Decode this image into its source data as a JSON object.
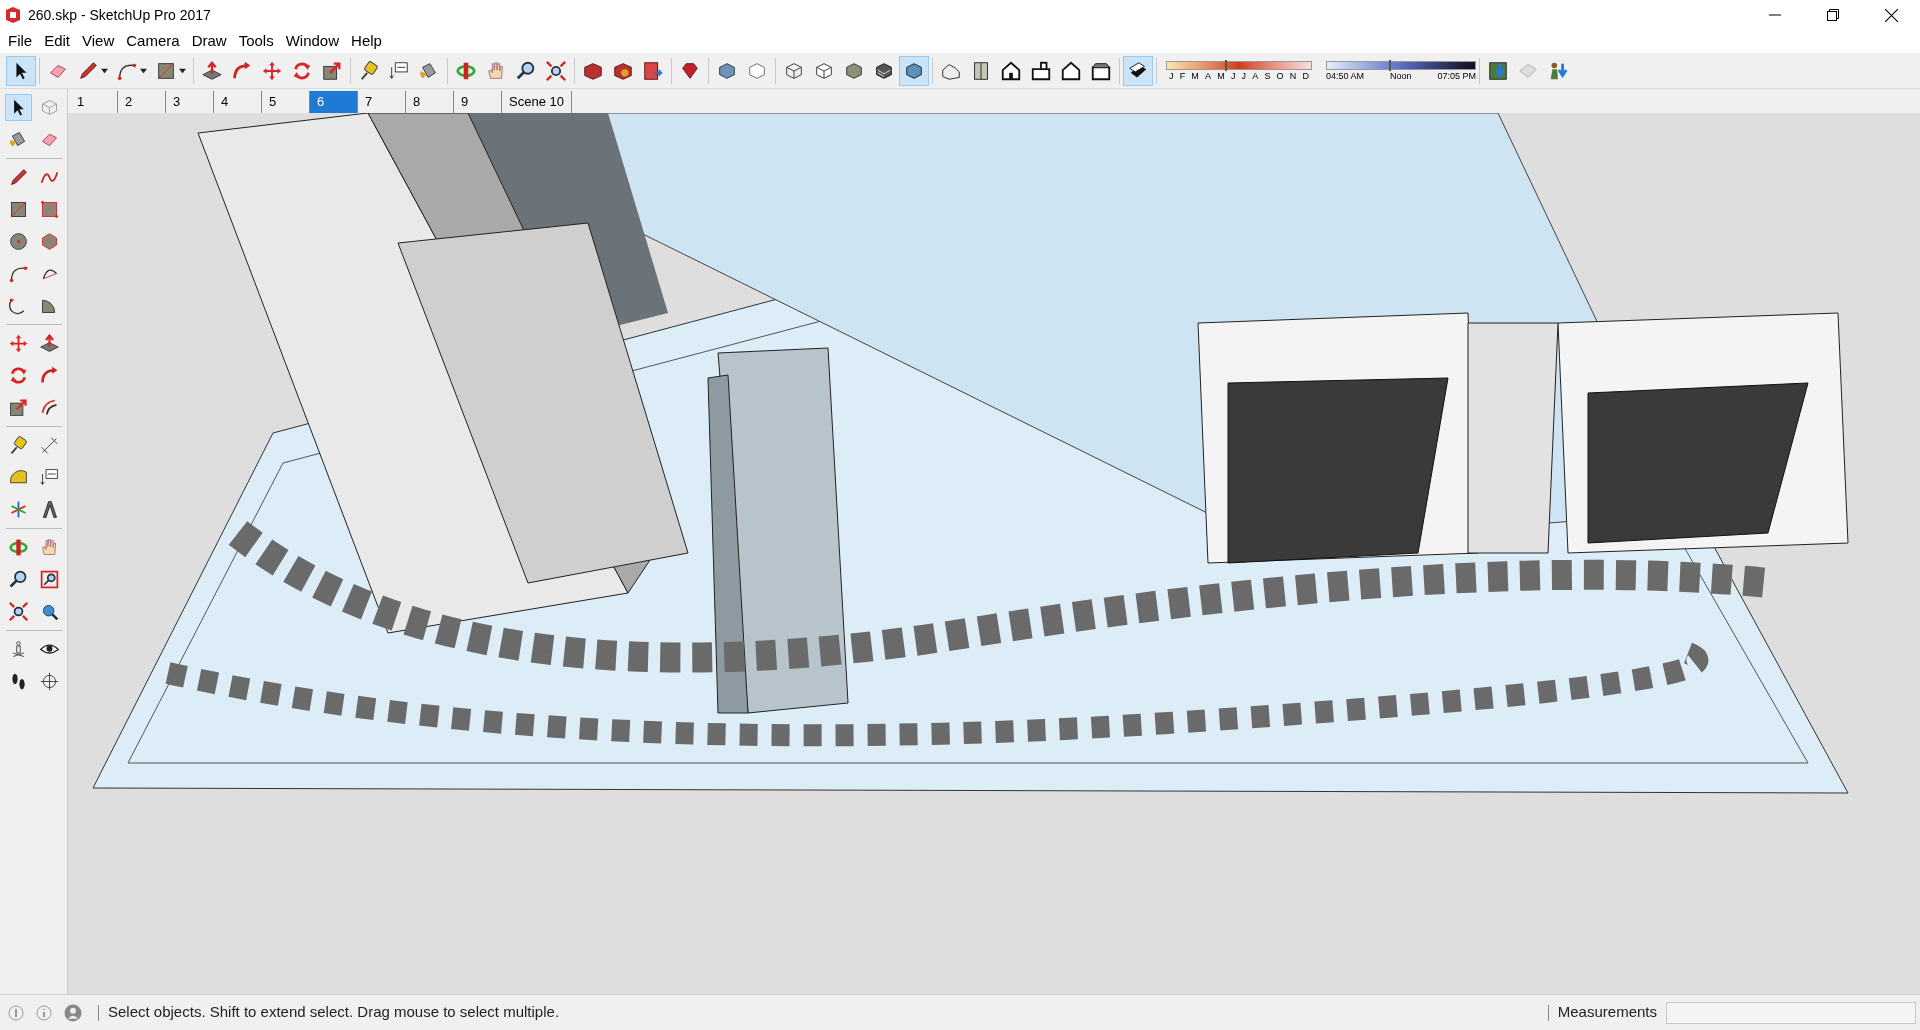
{
  "window": {
    "title": "260.skp - SketchUp Pro 2017"
  },
  "menu": [
    "File",
    "Edit",
    "View",
    "Camera",
    "Draw",
    "Tools",
    "Window",
    "Help"
  ],
  "main_toolbar": [
    [
      {
        "kind": "select",
        "selected": true,
        "dropdown": false
      }
    ],
    [
      {
        "kind": "eraser",
        "selected": false,
        "dropdown": false
      },
      {
        "kind": "pencil",
        "selected": false,
        "dropdown": true
      },
      {
        "kind": "arc",
        "selected": false,
        "dropdown": true
      },
      {
        "kind": "rectangle",
        "selected": false,
        "dropdown": true
      }
    ],
    [
      {
        "kind": "pushpull",
        "selected": false,
        "dropdown": false
      },
      {
        "kind": "followme",
        "selected": false,
        "dropdown": false
      },
      {
        "kind": "move",
        "selected": false,
        "dropdown": false
      },
      {
        "kind": "rotate",
        "selected": false,
        "dropdown": false
      },
      {
        "kind": "scale",
        "selected": false,
        "dropdown": false
      }
    ],
    [
      {
        "kind": "tape",
        "selected": false,
        "dropdown": false
      },
      {
        "kind": "text",
        "selected": false,
        "dropdown": false
      },
      {
        "kind": "paint",
        "selected": false,
        "dropdown": false
      }
    ],
    [
      {
        "kind": "orbit",
        "selected": false,
        "dropdown": false
      },
      {
        "kind": "pan",
        "selected": false,
        "dropdown": false
      },
      {
        "kind": "zoom",
        "selected": false,
        "dropdown": false
      },
      {
        "kind": "zoomext",
        "selected": false,
        "dropdown": false
      }
    ],
    [
      {
        "kind": "warehouse",
        "selected": false,
        "dropdown": false
      },
      {
        "kind": "extensions",
        "selected": false,
        "dropdown": false
      },
      {
        "kind": "send",
        "selected": false,
        "dropdown": false
      }
    ],
    [
      {
        "kind": "ruby",
        "selected": false,
        "dropdown": false
      }
    ],
    [
      {
        "kind": "xray",
        "selected": false,
        "dropdown": false
      },
      {
        "kind": "backedges",
        "selected": false,
        "dropdown": false
      }
    ],
    [
      {
        "kind": "wireframe",
        "selected": false,
        "dropdown": false
      },
      {
        "kind": "hiddenline",
        "selected": false,
        "dropdown": false
      },
      {
        "kind": "shaded",
        "selected": false,
        "dropdown": false
      },
      {
        "kind": "textured",
        "selected": false,
        "dropdown": false
      },
      {
        "kind": "monochrome",
        "selected": true,
        "dropdown": false
      }
    ],
    [
      {
        "kind": "iso",
        "selected": false,
        "dropdown": false
      },
      {
        "kind": "top",
        "selected": false,
        "dropdown": false
      },
      {
        "kind": "front",
        "selected": false,
        "dropdown": false
      },
      {
        "kind": "right",
        "selected": false,
        "dropdown": false
      },
      {
        "kind": "back",
        "selected": false,
        "dropdown": false
      },
      {
        "kind": "left",
        "selected": false,
        "dropdown": false
      }
    ],
    [
      {
        "kind": "shadows",
        "selected": true,
        "dropdown": false
      }
    ]
  ],
  "shadow_settings": {
    "months": [
      "J",
      "F",
      "M",
      "A",
      "M",
      "J",
      "J",
      "A",
      "S",
      "O",
      "N",
      "D"
    ],
    "month_slider": {
      "level": 0.4
    },
    "time_slider": {
      "level": 0.42
    },
    "time_start": "04:50 AM",
    "time_middle": "Noon",
    "time_end": "07:05 PM"
  },
  "location_toolbar": [
    {
      "kind": "geo"
    },
    {
      "kind": "sandbox"
    },
    {
      "kind": "addlocation"
    }
  ],
  "scenes": [
    {
      "label": "1",
      "selected": false
    },
    {
      "label": "2",
      "selected": false
    },
    {
      "label": "3",
      "selected": false
    },
    {
      "label": "4",
      "selected": false
    },
    {
      "label": "5",
      "selected": false
    },
    {
      "label": "6",
      "selected": true
    },
    {
      "label": "7",
      "selected": false
    },
    {
      "label": "8",
      "selected": false
    },
    {
      "label": "9",
      "selected": false
    },
    {
      "label": "Scene 10",
      "selected": false
    }
  ],
  "left_toolbar": [
    [
      {
        "kind": "select",
        "selected": true
      },
      {
        "kind": "component",
        "selected": false
      },
      {
        "kind": "paint",
        "selected": false
      },
      {
        "kind": "eraser",
        "selected": false
      }
    ],
    [
      {
        "kind": "pencil",
        "selected": false
      },
      {
        "kind": "freehand",
        "selected": false
      },
      {
        "kind": "rectangle",
        "selected": false
      },
      {
        "kind": "rotrect",
        "selected": false
      },
      {
        "kind": "circle",
        "selected": false
      },
      {
        "kind": "polygon",
        "selected": false
      },
      {
        "kind": "arc",
        "selected": false
      },
      {
        "kind": "arc2",
        "selected": false
      },
      {
        "kind": "arc3",
        "selected": false
      },
      {
        "kind": "pie",
        "selected": false
      }
    ],
    [
      {
        "kind": "move",
        "selected": false
      },
      {
        "kind": "pushpull",
        "selected": false
      },
      {
        "kind": "rotate",
        "selected": false
      },
      {
        "kind": "followme",
        "selected": false
      },
      {
        "kind": "scale",
        "selected": false
      },
      {
        "kind": "offset",
        "selected": false
      }
    ],
    [
      {
        "kind": "tape",
        "selected": false
      },
      {
        "kind": "dimension",
        "selected": false
      },
      {
        "kind": "protractor",
        "selected": false
      },
      {
        "kind": "text",
        "selected": false
      },
      {
        "kind": "axes",
        "selected": false
      },
      {
        "kind": "text3d",
        "selected": false
      }
    ],
    [
      {
        "kind": "orbit",
        "selected": false
      },
      {
        "kind": "pan",
        "selected": false
      },
      {
        "kind": "zoom",
        "selected": false
      },
      {
        "kind": "zoomwin",
        "selected": false
      },
      {
        "kind": "zoomext",
        "selected": false
      },
      {
        "kind": "previous",
        "selected": false
      }
    ],
    [
      {
        "kind": "position",
        "selected": false
      },
      {
        "kind": "lookaround",
        "selected": false
      },
      {
        "kind": "walk",
        "selected": false
      },
      {
        "kind": "section",
        "selected": false
      }
    ]
  ],
  "status_bar": {
    "message": "Select objects. Shift to extend select. Drag mouse to select multiple.",
    "measurements_label": "Measurements"
  }
}
